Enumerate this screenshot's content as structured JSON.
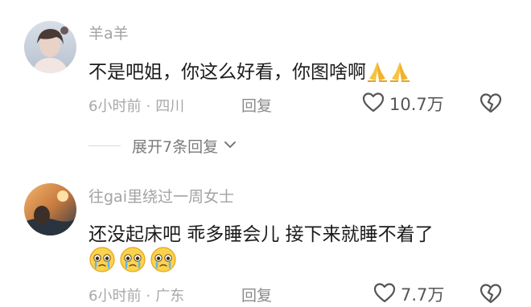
{
  "comments": [
    {
      "username": "羊a羊",
      "text": "不是吧姐，你这么好看，你图啥啊",
      "time": "6小时前",
      "location": "四川",
      "reply_label": "回复",
      "likes": "10.7万",
      "emojis": [
        "pray",
        "pray"
      ]
    },
    {
      "username": "往gai里绕过一周女士",
      "text": "还没起床吧 乖多睡会儿 接下来就睡不着了",
      "time": "6小时前",
      "location": "广东",
      "reply_label": "回复",
      "likes": "7.7万",
      "emojis": [
        "crying-face",
        "crying-face",
        "crying-face"
      ]
    }
  ],
  "expand_replies": "展开7条回复",
  "colors": {
    "username": "#a3a3a3",
    "text": "#1b1b1b",
    "meta": "#a8a8a8"
  }
}
